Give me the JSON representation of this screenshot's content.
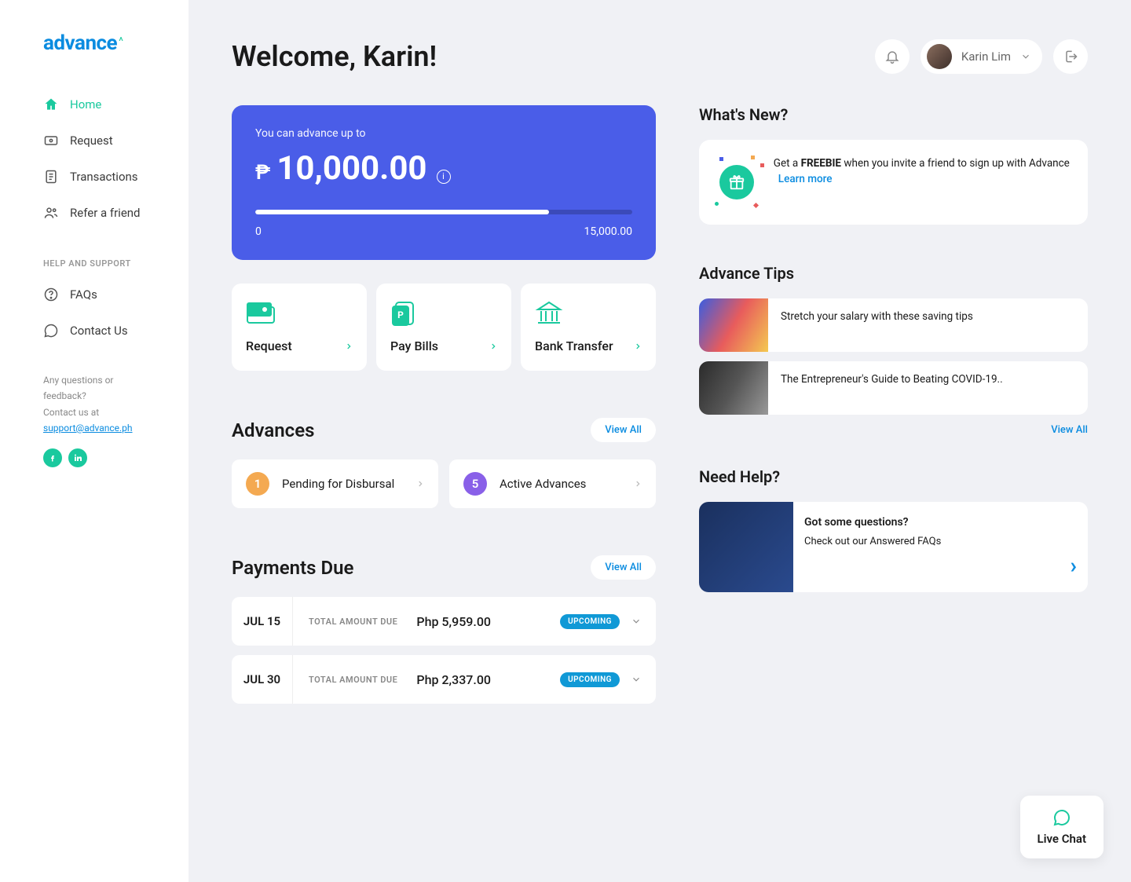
{
  "brand": "advance",
  "nav": {
    "items": [
      {
        "label": "Home",
        "active": true
      },
      {
        "label": "Request"
      },
      {
        "label": "Transactions"
      },
      {
        "label": "Refer a friend"
      }
    ],
    "help_section_title": "HELP AND SUPPORT",
    "help_items": [
      {
        "label": "FAQs"
      },
      {
        "label": "Contact Us"
      }
    ],
    "footer_line1": "Any questions or feedback?",
    "footer_line2": "Contact us at",
    "footer_email": "support@advance.ph"
  },
  "header": {
    "title": "Welcome, Karin!",
    "user_name": "Karin Lim"
  },
  "hero": {
    "label": "You can advance up to",
    "currency": "₱",
    "amount": "10,000.00",
    "range_min": "0",
    "range_max": "15,000.00",
    "fill_pct": 78
  },
  "actions": [
    {
      "label": "Request"
    },
    {
      "label": "Pay Bills"
    },
    {
      "label": "Bank Transfer"
    }
  ],
  "advances": {
    "title": "Advances",
    "view_all": "View All",
    "chips": [
      {
        "count": "1",
        "label": "Pending for Disbursal",
        "color": "orange"
      },
      {
        "count": "5",
        "label": "Active Advances",
        "color": "purple"
      }
    ]
  },
  "payments": {
    "title": "Payments Due",
    "view_all": "View All",
    "due_label": "TOTAL AMOUNT DUE",
    "rows": [
      {
        "date": "JUL 15",
        "amount": "Php 5,959.00",
        "status": "UPCOMING"
      },
      {
        "date": "JUL 30",
        "amount": "Php 2,337.00",
        "status": "UPCOMING"
      }
    ]
  },
  "whats_new": {
    "title": "What's New?",
    "text_before": "Get a ",
    "text_bold": "FREEBIE",
    "text_after": " when you invite a friend to sign up with Advance",
    "learn_more": "Learn more"
  },
  "tips": {
    "title": "Advance Tips",
    "items": [
      {
        "text": "Stretch your salary with these saving tips"
      },
      {
        "text": "The Entrepreneur's Guide to Beating COVID-19.."
      }
    ],
    "view_all": "View All"
  },
  "help": {
    "title": "Need Help?",
    "question": "Got some questions?",
    "sub": "Check out our Answered FAQs"
  },
  "chat": {
    "label": "Live Chat"
  }
}
